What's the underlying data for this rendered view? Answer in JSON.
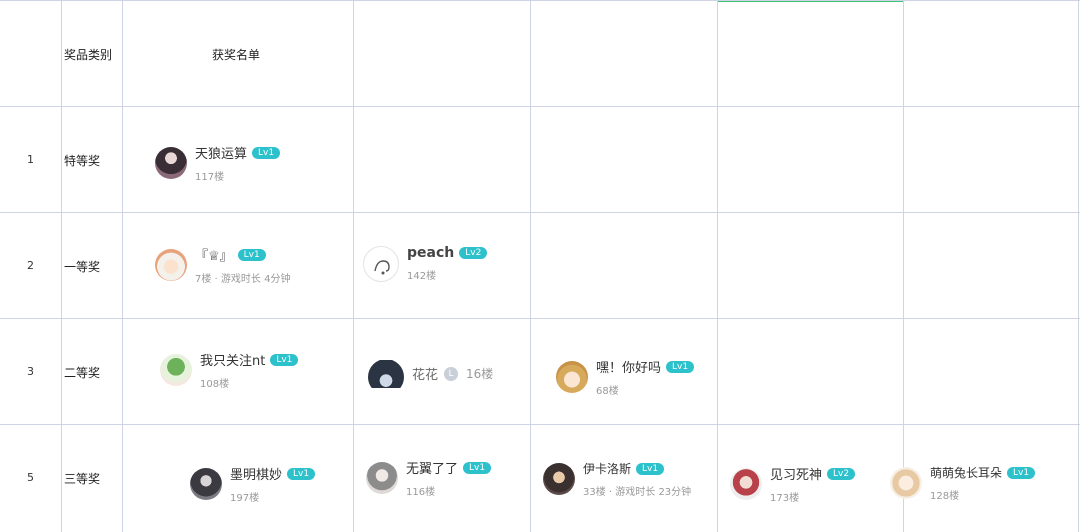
{
  "header": {
    "category_label": "奖品类别",
    "winners_label": "获奖名单"
  },
  "rows": [
    {
      "num": "1",
      "category": "特等奖"
    },
    {
      "num": "2",
      "category": "一等奖"
    },
    {
      "num": "3",
      "category": "二等奖"
    },
    {
      "num": "5",
      "category": "三等奖"
    }
  ],
  "winners": {
    "r1c1": {
      "name": "天狼运算",
      "level": "Lv1",
      "floor": "117楼"
    },
    "r2c1": {
      "name": "『♕』",
      "level": "Lv1",
      "floor": "7楼 · 游戏时长 4分钟"
    },
    "r2c2": {
      "name": "peach",
      "level": "Lv2",
      "floor": "142楼"
    },
    "r3c1": {
      "name": "我只关注nt",
      "level": "Lv1",
      "floor": "108楼"
    },
    "r3c2": {
      "name": "花花",
      "badge": "L",
      "floor": "16楼"
    },
    "r3c3": {
      "name": "嘿！你好吗",
      "level": "Lv1",
      "floor": "68楼"
    },
    "r4c1": {
      "name": "墨明棋妙",
      "level": "Lv1",
      "floor": "197楼"
    },
    "r4c2": {
      "name": "无翼了了",
      "level": "Lv1",
      "floor": "116楼"
    },
    "r4c3": {
      "name": "伊卡洛斯",
      "level": "Lv1",
      "floor": "33楼 · 游戏时长 23分钟"
    },
    "r4c4": {
      "name": "见习死神",
      "level": "Lv2",
      "floor": "173楼"
    },
    "r4c5": {
      "name": "萌萌兔长耳朵",
      "level": "Lv1",
      "floor": "128楼"
    }
  },
  "colors": {
    "grid": "#cfd5e4",
    "accent": "#3fc27a",
    "level_badge": "#2dc1cc"
  }
}
